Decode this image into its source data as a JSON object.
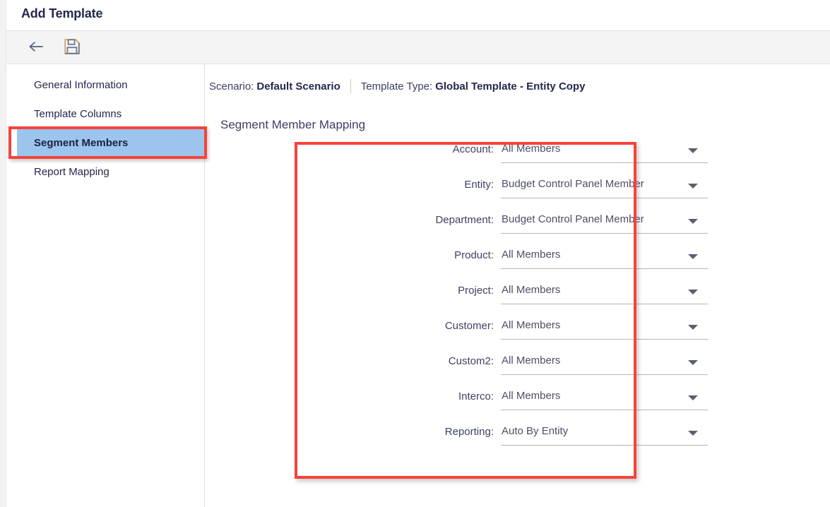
{
  "window": {
    "title": "Add Template"
  },
  "toolbar": {
    "back_label": "Back",
    "back_icon": "arrow-left-icon",
    "save_label": "Save",
    "save_icon": "floppy-disk-save-icon"
  },
  "sidebar": {
    "items": [
      {
        "label": "General Information",
        "active": false
      },
      {
        "label": "Template Columns",
        "active": false
      },
      {
        "label": "Segment Members",
        "active": true
      },
      {
        "label": "Report Mapping",
        "active": false
      }
    ]
  },
  "main": {
    "breadcrumb": {
      "scenario_label": "Scenario:",
      "scenario_value": "Default Scenario",
      "template_type_label": "Template Type:",
      "template_type_value": "Global Template - Entity Copy"
    },
    "section_title": "Segment Member Mapping",
    "fields": [
      {
        "label": "Account:",
        "value": "All Members"
      },
      {
        "label": "Entity:",
        "value": "Budget Control Panel Member"
      },
      {
        "label": "Department:",
        "value": "Budget Control Panel Member"
      },
      {
        "label": "Product:",
        "value": "All Members"
      },
      {
        "label": "Project:",
        "value": "All Members"
      },
      {
        "label": "Customer:",
        "value": "All Members"
      },
      {
        "label": "Custom2:",
        "value": "All Members"
      },
      {
        "label": "Interco:",
        "value": "All Members"
      },
      {
        "label": "Reporting:",
        "value": "Auto By Entity"
      }
    ]
  },
  "annotations": {
    "highlight_color": "#f9423a",
    "active_nav_color": "#9cc5ee"
  }
}
